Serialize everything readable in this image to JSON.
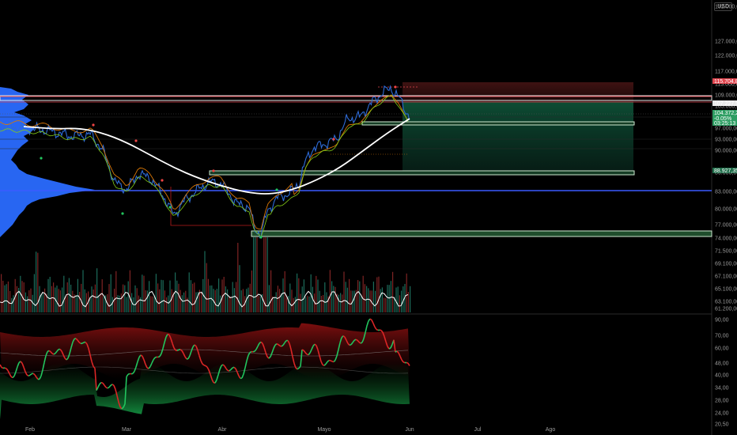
{
  "header": {
    "symbol_text": "",
    "currency": "USD"
  },
  "colors": {
    "background": "#000000",
    "profile": "#2a6bff",
    "up": "#22c55e",
    "down": "#ef4444",
    "ma": "#ffffff",
    "poc": "#3b5bff",
    "zone_border": "#c8e6c9",
    "tp_zone": "#0d3b2a",
    "sl_zone": "#3a1212"
  },
  "price_axis": {
    "ticks": [
      "132.000,00",
      "127.000,00",
      "122.000,00",
      "117.000,00",
      "113.000,00",
      "109.000,00",
      "105.000,00",
      "101.000,00",
      "97.000,00",
      "93.000,00",
      "90.000,00",
      "86.000,00",
      "83.000,00",
      "80.000,00",
      "77.000,00",
      "74.000,00",
      "71.500,00",
      "69.100,00",
      "67.100,00",
      "65.100,00",
      "63.100,00",
      "61.200,00"
    ],
    "tags": [
      {
        "text": "115.704,83",
        "color": "#e0464f"
      },
      {
        "text": "107.227,52",
        "color": "#e8e8e8",
        "ink": "#000"
      },
      {
        "text": "104.372,22",
        "color": "#2e9e63"
      },
      {
        "text": "-0,05%",
        "color": "#2e9e63"
      },
      {
        "text": "03:25:13",
        "color": "#2e9e63"
      },
      {
        "text": "88.927,35",
        "color": "#1f6e4a"
      }
    ]
  },
  "osc_axis": {
    "ticks": [
      "90,00",
      "70,00",
      "60,00",
      "48,00",
      "40,00",
      "34,00",
      "28,00",
      "24,00",
      "20,50"
    ]
  },
  "time_axis": {
    "ticks": [
      "Feb",
      "Mar",
      "Abr",
      "Mayo",
      "Jun",
      "Jul",
      "Ago"
    ]
  },
  "chart_data": {
    "type": "line",
    "title": "",
    "xlabel": "",
    "ylabel": "",
    "x": [
      "Feb",
      "Mar",
      "Abr",
      "Mayo",
      "Jun"
    ],
    "ylim": [
      61200,
      132000
    ],
    "series": [
      {
        "values": [
          98500,
          97000,
          83000,
          76500,
          82000,
          94000,
          103000,
          110500,
          104372
        ]
      },
      {
        "values": [
          101000,
          98500,
          93500,
          85000,
          83500,
          88500,
          97000,
          103000,
          104500
        ]
      }
    ],
    "levels": [
      {
        "y": 109700
      },
      {
        "y": 107227
      },
      {
        "y": 103700
      },
      {
        "y": 88927
      },
      {
        "y": 83700
      },
      {
        "y": 75800
      }
    ],
    "oscillator": {
      "ylim": [
        20.5,
        90
      ],
      "last": 40
    }
  }
}
